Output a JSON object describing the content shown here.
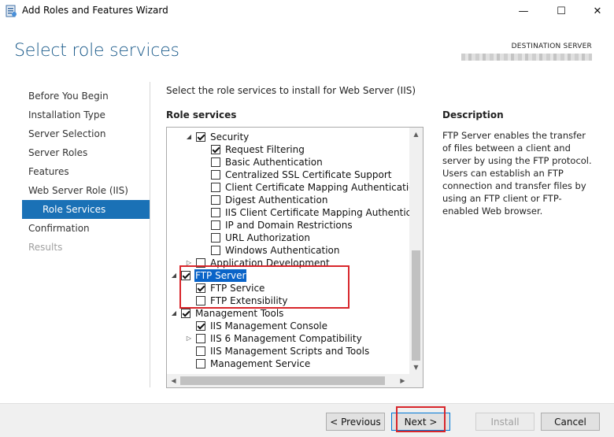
{
  "window": {
    "title": "Add Roles and Features Wizard",
    "minimize_glyph": "—",
    "maximize_glyph": "☐",
    "close_glyph": "✕"
  },
  "header": {
    "page_title": "Select role services",
    "destination_label": "DESTINATION SERVER"
  },
  "nav": {
    "items": [
      {
        "label": "Before You Begin",
        "state": "normal"
      },
      {
        "label": "Installation Type",
        "state": "normal"
      },
      {
        "label": "Server Selection",
        "state": "normal"
      },
      {
        "label": "Server Roles",
        "state": "normal"
      },
      {
        "label": "Features",
        "state": "normal"
      },
      {
        "label": "Web Server Role (IIS)",
        "state": "normal"
      },
      {
        "label": "Role Services",
        "state": "active"
      },
      {
        "label": "Confirmation",
        "state": "normal"
      },
      {
        "label": "Results",
        "state": "disabled"
      }
    ]
  },
  "main": {
    "instruction": "Select the role services to install for Web Server (IIS)",
    "role_services_header": "Role services",
    "tree": [
      {
        "label": "Security",
        "level": 1,
        "expander": "expanded",
        "checked": true
      },
      {
        "label": "Request Filtering",
        "level": 2,
        "expander": "none",
        "checked": true
      },
      {
        "label": "Basic Authentication",
        "level": 2,
        "expander": "none",
        "checked": false
      },
      {
        "label": "Centralized SSL Certificate Support",
        "level": 2,
        "expander": "none",
        "checked": false
      },
      {
        "label": "Client Certificate Mapping Authentication",
        "level": 2,
        "expander": "none",
        "checked": false
      },
      {
        "label": "Digest Authentication",
        "level": 2,
        "expander": "none",
        "checked": false
      },
      {
        "label": "IIS Client Certificate Mapping Authenticatic",
        "level": 2,
        "expander": "none",
        "checked": false
      },
      {
        "label": "IP and Domain Restrictions",
        "level": 2,
        "expander": "none",
        "checked": false
      },
      {
        "label": "URL Authorization",
        "level": 2,
        "expander": "none",
        "checked": false
      },
      {
        "label": "Windows Authentication",
        "level": 2,
        "expander": "none",
        "checked": false
      },
      {
        "label": "Application Development",
        "level": 1,
        "expander": "collapsed",
        "checked": false
      },
      {
        "label": "FTP Server",
        "level": 0,
        "expander": "expanded",
        "checked": true,
        "selected": true
      },
      {
        "label": "FTP Service",
        "level": 1,
        "expander": "none",
        "checked": true
      },
      {
        "label": "FTP Extensibility",
        "level": 1,
        "expander": "none",
        "checked": false
      },
      {
        "label": "Management Tools",
        "level": 0,
        "expander": "expanded",
        "checked": true
      },
      {
        "label": "IIS Management Console",
        "level": 1,
        "expander": "none",
        "checked": true
      },
      {
        "label": "IIS 6 Management Compatibility",
        "level": 1,
        "expander": "collapsed",
        "checked": false
      },
      {
        "label": "IIS Management Scripts and Tools",
        "level": 1,
        "expander": "none",
        "checked": false
      },
      {
        "label": "Management Service",
        "level": 1,
        "expander": "none",
        "checked": false
      }
    ],
    "description_header": "Description",
    "description_text": "FTP Server enables the transfer of files between a client and server by using the FTP protocol. Users can establish an FTP connection and transfer files by using an FTP client or FTP-enabled Web browser."
  },
  "footer": {
    "previous_label": "< Previous",
    "next_label": "Next >",
    "install_label": "Install",
    "cancel_label": "Cancel"
  },
  "colors": {
    "title_blue": "#1a5a8a",
    "nav_active": "#1a71b6",
    "selection": "#0a64c8",
    "highlight_box": "#d8262b"
  },
  "icons": {
    "expanded": "◢",
    "collapsed": "▷",
    "scroll_up": "▲",
    "scroll_down": "▼",
    "scroll_left": "◀",
    "scroll_right": "▶"
  }
}
